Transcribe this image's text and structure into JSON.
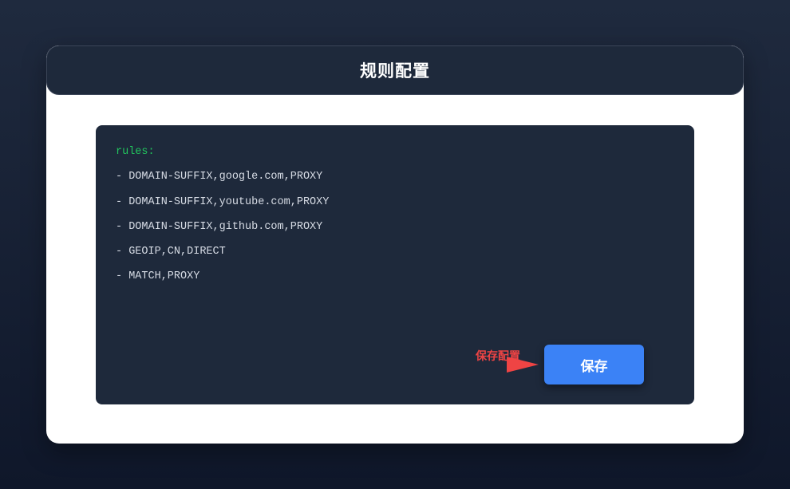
{
  "header": {
    "title": "规则配置"
  },
  "editor": {
    "lines": [
      "rules:",
      "- DOMAIN-SUFFIX,google.com,PROXY",
      "- DOMAIN-SUFFIX,youtube.com,PROXY",
      "- DOMAIN-SUFFIX,github.com,PROXY",
      "- GEOIP,CN,DIRECT",
      "- MATCH,PROXY"
    ]
  },
  "actions": {
    "save_label": "保存"
  },
  "annotation": {
    "label": "保存配置",
    "color": "#ef4444"
  },
  "colors": {
    "background": "#0f172a",
    "panel": "#1e293b",
    "accent": "#3b82f6",
    "key": "#22c55e"
  }
}
